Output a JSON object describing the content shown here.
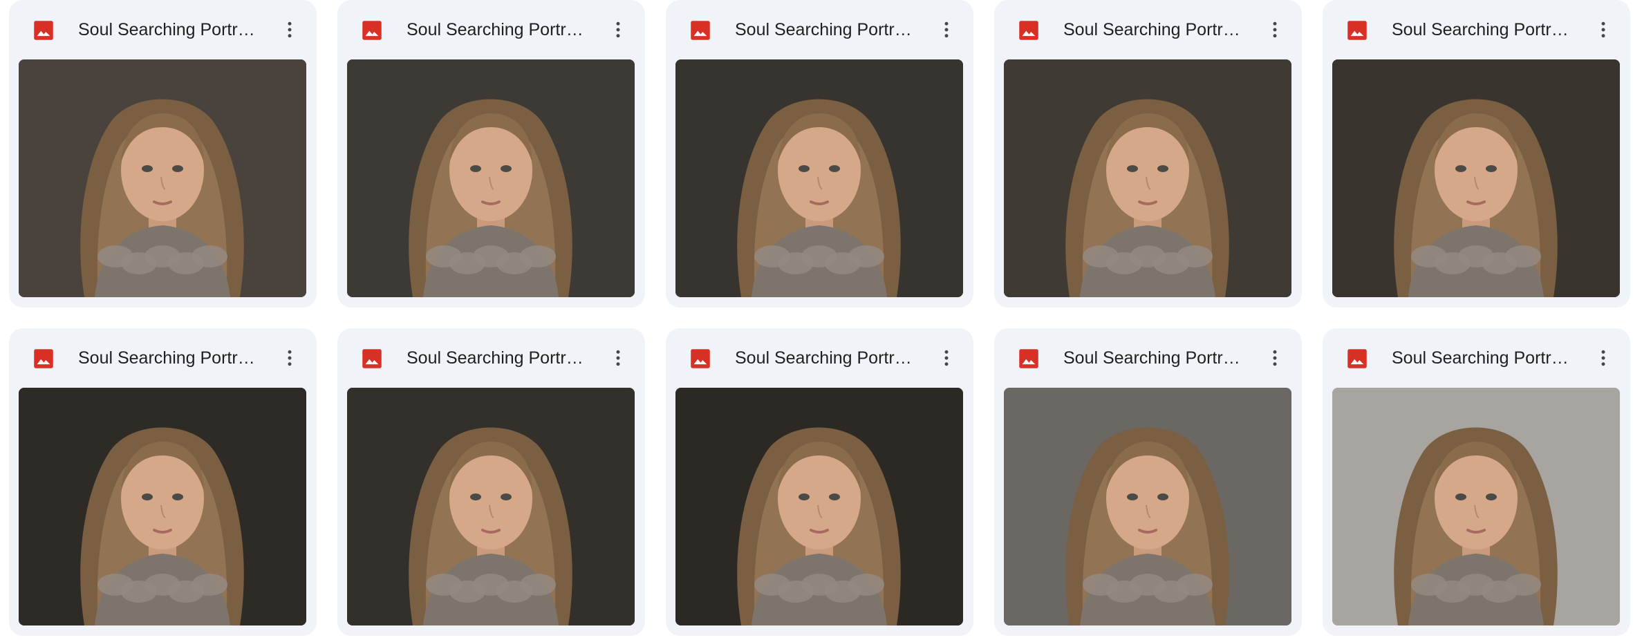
{
  "files": [
    {
      "title": "Soul Searching Portraits",
      "icon": "image-file-icon",
      "bg": "#4a433d"
    },
    {
      "title": "Soul Searching Portraits",
      "icon": "image-file-icon",
      "bg": "#3d3a35"
    },
    {
      "title": "Soul Searching Portraits",
      "icon": "image-file-icon",
      "bg": "#37342f"
    },
    {
      "title": "Soul Searching Portraits",
      "icon": "image-file-icon",
      "bg": "#3f3a34"
    },
    {
      "title": "Soul Searching Portraits",
      "icon": "image-file-icon",
      "bg": "#3a342e"
    },
    {
      "title": "Soul Searching Portraits",
      "icon": "image-file-icon",
      "bg": "#2e2a26"
    },
    {
      "title": "Soul Searching Portraits",
      "icon": "image-file-icon",
      "bg": "#332f2a"
    },
    {
      "title": "Soul Searching Portraits",
      "icon": "image-file-icon",
      "bg": "#2c2925"
    },
    {
      "title": "Soul Searching Portraits",
      "icon": "image-file-icon",
      "bg": "#6b6762"
    },
    {
      "title": "Soul Searching Portraits",
      "icon": "image-file-icon",
      "bg": "#a8a5a0"
    }
  ],
  "colors": {
    "card_bg": "#f0f4f9",
    "icon_red": "#d93025",
    "title_text": "#1f1f1f",
    "more_icon": "#444746"
  }
}
